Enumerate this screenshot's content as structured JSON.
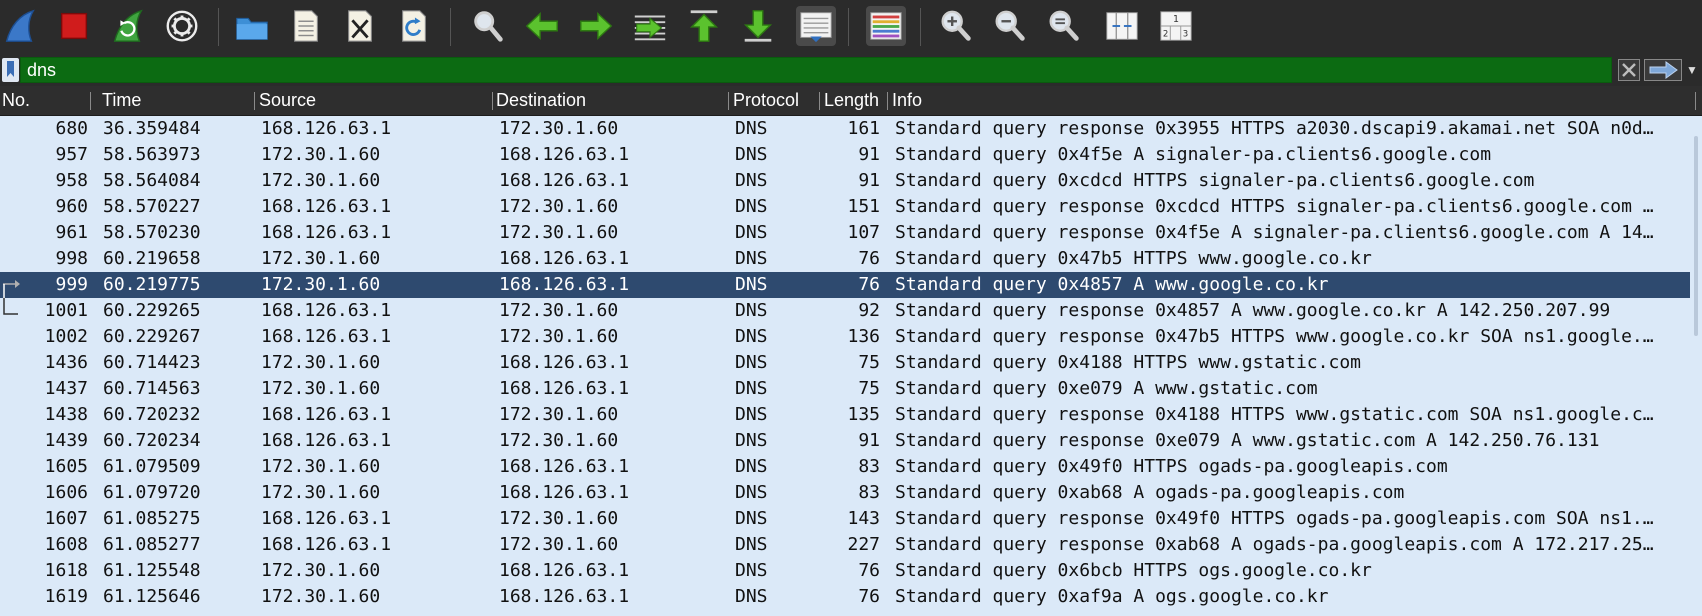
{
  "filter": {
    "value": "dns",
    "placeholder": ""
  },
  "columns": [
    "No.",
    "Time",
    "Source",
    "Destination",
    "Protocol",
    "Length",
    "Info"
  ],
  "selected_row": 6,
  "packets": [
    {
      "no": "680",
      "time": "36.359484",
      "src": "168.126.63.1",
      "dst": "172.30.1.60",
      "proto": "DNS",
      "len": "161",
      "info": "Standard query response 0x3955 HTTPS a2030.dscapi9.akamai.net SOA n0d…"
    },
    {
      "no": "957",
      "time": "58.563973",
      "src": "172.30.1.60",
      "dst": "168.126.63.1",
      "proto": "DNS",
      "len": "91",
      "info": "Standard query 0x4f5e A signaler-pa.clients6.google.com"
    },
    {
      "no": "958",
      "time": "58.564084",
      "src": "172.30.1.60",
      "dst": "168.126.63.1",
      "proto": "DNS",
      "len": "91",
      "info": "Standard query 0xcdcd HTTPS signaler-pa.clients6.google.com"
    },
    {
      "no": "960",
      "time": "58.570227",
      "src": "168.126.63.1",
      "dst": "172.30.1.60",
      "proto": "DNS",
      "len": "151",
      "info": "Standard query response 0xcdcd HTTPS signaler-pa.clients6.google.com …"
    },
    {
      "no": "961",
      "time": "58.570230",
      "src": "168.126.63.1",
      "dst": "172.30.1.60",
      "proto": "DNS",
      "len": "107",
      "info": "Standard query response 0x4f5e A signaler-pa.clients6.google.com A 14…"
    },
    {
      "no": "998",
      "time": "60.219658",
      "src": "172.30.1.60",
      "dst": "168.126.63.1",
      "proto": "DNS",
      "len": "76",
      "info": "Standard query 0x47b5 HTTPS www.google.co.kr"
    },
    {
      "no": "999",
      "time": "60.219775",
      "src": "172.30.1.60",
      "dst": "168.126.63.1",
      "proto": "DNS",
      "len": "76",
      "info": "Standard query 0x4857 A www.google.co.kr"
    },
    {
      "no": "1001",
      "time": "60.229265",
      "src": "168.126.63.1",
      "dst": "172.30.1.60",
      "proto": "DNS",
      "len": "92",
      "info": "Standard query response 0x4857 A www.google.co.kr A 142.250.207.99"
    },
    {
      "no": "1002",
      "time": "60.229267",
      "src": "168.126.63.1",
      "dst": "172.30.1.60",
      "proto": "DNS",
      "len": "136",
      "info": "Standard query response 0x47b5 HTTPS www.google.co.kr SOA ns1.google.…"
    },
    {
      "no": "1436",
      "time": "60.714423",
      "src": "172.30.1.60",
      "dst": "168.126.63.1",
      "proto": "DNS",
      "len": "75",
      "info": "Standard query 0x4188 HTTPS www.gstatic.com"
    },
    {
      "no": "1437",
      "time": "60.714563",
      "src": "172.30.1.60",
      "dst": "168.126.63.1",
      "proto": "DNS",
      "len": "75",
      "info": "Standard query 0xe079 A www.gstatic.com"
    },
    {
      "no": "1438",
      "time": "60.720232",
      "src": "168.126.63.1",
      "dst": "172.30.1.60",
      "proto": "DNS",
      "len": "135",
      "info": "Standard query response 0x4188 HTTPS www.gstatic.com SOA ns1.google.c…"
    },
    {
      "no": "1439",
      "time": "60.720234",
      "src": "168.126.63.1",
      "dst": "172.30.1.60",
      "proto": "DNS",
      "len": "91",
      "info": "Standard query response 0xe079 A www.gstatic.com A 142.250.76.131"
    },
    {
      "no": "1605",
      "time": "61.079509",
      "src": "172.30.1.60",
      "dst": "168.126.63.1",
      "proto": "DNS",
      "len": "83",
      "info": "Standard query 0x49f0 HTTPS ogads-pa.googleapis.com"
    },
    {
      "no": "1606",
      "time": "61.079720",
      "src": "172.30.1.60",
      "dst": "168.126.63.1",
      "proto": "DNS",
      "len": "83",
      "info": "Standard query 0xab68 A ogads-pa.googleapis.com"
    },
    {
      "no": "1607",
      "time": "61.085275",
      "src": "168.126.63.1",
      "dst": "172.30.1.60",
      "proto": "DNS",
      "len": "143",
      "info": "Standard query response 0x49f0 HTTPS ogads-pa.googleapis.com SOA ns1.…"
    },
    {
      "no": "1608",
      "time": "61.085277",
      "src": "168.126.63.1",
      "dst": "172.30.1.60",
      "proto": "DNS",
      "len": "227",
      "info": "Standard query response 0xab68 A ogads-pa.googleapis.com A 172.217.25…"
    },
    {
      "no": "1618",
      "time": "61.125548",
      "src": "172.30.1.60",
      "dst": "168.126.63.1",
      "proto": "DNS",
      "len": "76",
      "info": "Standard query 0x6bcb HTTPS ogs.google.co.kr"
    },
    {
      "no": "1619",
      "time": "61.125646",
      "src": "172.30.1.60",
      "dst": "168.126.63.1",
      "proto": "DNS",
      "len": "76",
      "info": "Standard query 0xaf9a A ogs.google.co.kr"
    }
  ]
}
